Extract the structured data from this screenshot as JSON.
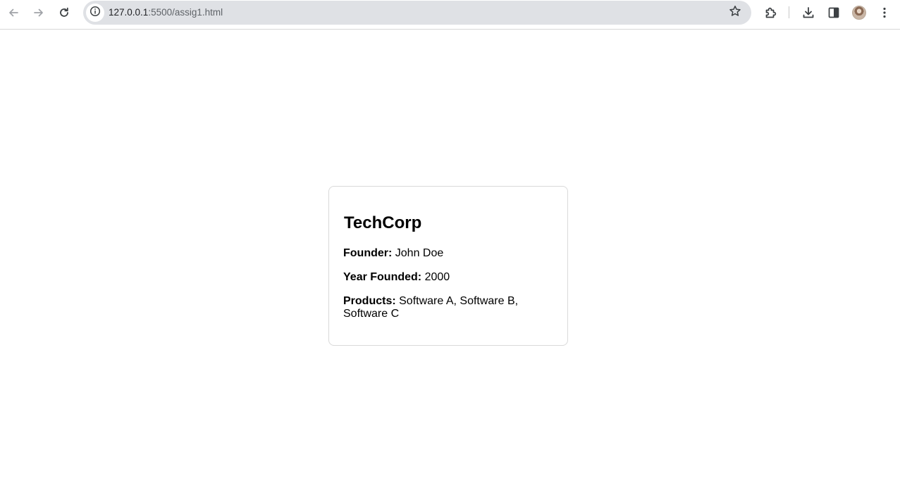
{
  "browser": {
    "url_host": "127.0.0.1",
    "url_rest": ":5500/assig1.html",
    "icons": {
      "back": "arrow-left-icon",
      "forward": "arrow-right-icon",
      "reload": "reload-icon",
      "site_info": "info-icon",
      "bookmark": "star-icon",
      "extensions": "puzzle-icon",
      "downloads": "download-icon",
      "side_panel": "side-panel-icon",
      "profile": "avatar",
      "menu": "kebab-menu-icon"
    }
  },
  "card": {
    "title": "TechCorp",
    "founder_label": "Founder:",
    "founder_value": "John Doe",
    "year_label": "Year Founded:",
    "year_value": "2000",
    "products_label": "Products:",
    "products_value": "Software A, Software B, Software C"
  },
  "colors": {
    "toolbar_bg": "#ffffff",
    "omnibox_bg": "#dfe1e5",
    "card_border": "#d9d9d9",
    "text": "#000000"
  }
}
